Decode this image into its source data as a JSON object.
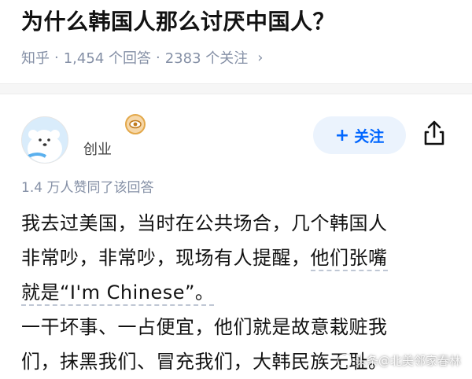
{
  "question": {
    "title": "为什么韩国人那么讨厌中国人？"
  },
  "meta": {
    "source": "知乎",
    "answers": "1,454 个回答",
    "followers": "2383 个关注",
    "sep": "·",
    "chevron": "›"
  },
  "author": {
    "name": "创业",
    "avatar_icon": "polar-bear-avatar",
    "badge_icon": "eye-badge-icon"
  },
  "actions": {
    "follow_plus": "+",
    "follow_label": "关注",
    "share_icon": "share-icon"
  },
  "answer": {
    "vote_text": "1.4 万人赞同了该回答",
    "lines": [
      "我去过美国，当时在公共场合，几个韩国人",
      "非常吵，非常吵，现场有人提醒，",
      "就是“I'm Chinese”。",
      "一干坏事、一占便宜，他们就是故意栽赃我",
      "们，抹黑我们、冒充我们，大韩民族无耻。"
    ],
    "line2_underlined": "他们张嘴"
  },
  "watermark": {
    "text": "头条@北美邻家春林"
  },
  "colors": {
    "accent": "#0066ff",
    "follow_bg": "#ebf3fd",
    "meta_gray": "#8590a6",
    "text": "#121212"
  }
}
